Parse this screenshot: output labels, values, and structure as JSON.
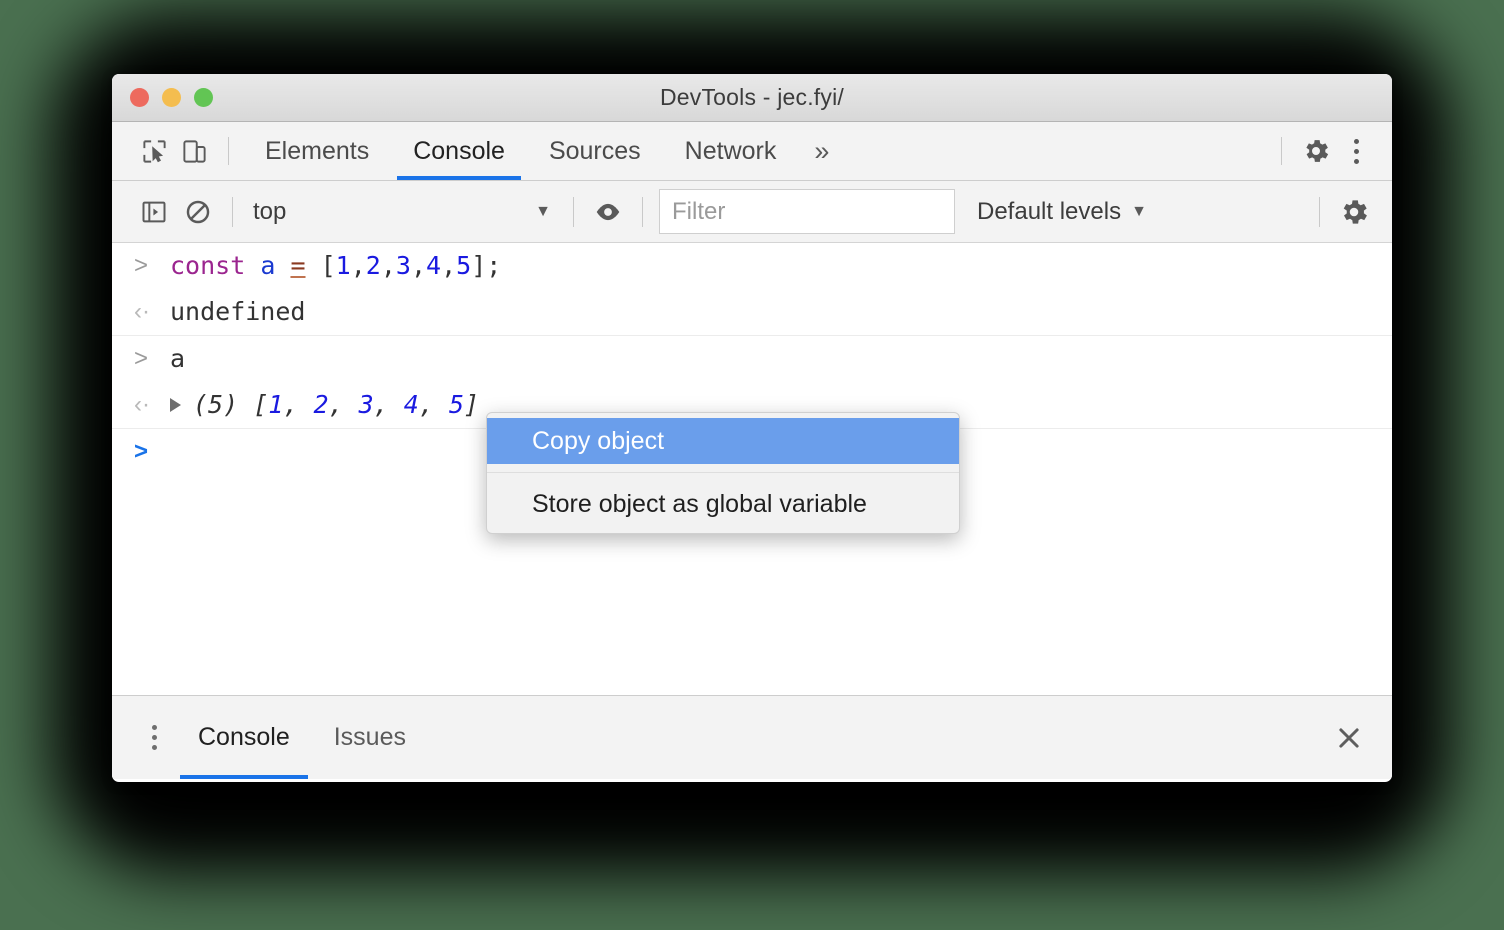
{
  "window": {
    "title": "DevTools - jec.fyi/",
    "traffic_lights": [
      {
        "name": "close",
        "color": "#ed6a5e"
      },
      {
        "name": "minimize",
        "color": "#f4bd4f"
      },
      {
        "name": "zoom",
        "color": "#62c554"
      }
    ]
  },
  "toolbar": {
    "inspect_icon": "inspect-element-icon",
    "device_icon": "device-toolbar-icon",
    "settings_icon": "gear-icon",
    "more_icon": "more-vertical-icon",
    "more_tabs_label": "»"
  },
  "tabs": [
    {
      "label": "Elements",
      "active": false
    },
    {
      "label": "Console",
      "active": true
    },
    {
      "label": "Sources",
      "active": false
    },
    {
      "label": "Network",
      "active": false
    }
  ],
  "console_toolbar": {
    "sidebar_toggle_icon": "console-sidebar-icon",
    "clear_icon": "clear-console-icon",
    "context_value": "top",
    "context_caret": "▼",
    "eye_icon": "live-expression-eye-icon",
    "filter_placeholder": "Filter",
    "filter_value": "",
    "levels_label": "Default levels",
    "levels_caret": "▼",
    "settings_icon": "gear-icon"
  },
  "console": {
    "groups": [
      {
        "messages": [
          {
            "gutter": ">",
            "gutter_kind": "input",
            "type": "code",
            "tokens": [
              {
                "text": "const",
                "cls": "kw"
              },
              {
                "text": " ",
                "cls": "punct"
              },
              {
                "text": "a",
                "cls": "var"
              },
              {
                "text": " ",
                "cls": "punct"
              },
              {
                "text": "=",
                "cls": "op"
              },
              {
                "text": " [",
                "cls": "punct"
              },
              {
                "text": "1",
                "cls": "num"
              },
              {
                "text": ",",
                "cls": "punct"
              },
              {
                "text": "2",
                "cls": "num"
              },
              {
                "text": ",",
                "cls": "punct"
              },
              {
                "text": "3",
                "cls": "num"
              },
              {
                "text": ",",
                "cls": "punct"
              },
              {
                "text": "4",
                "cls": "num"
              },
              {
                "text": ",",
                "cls": "punct"
              },
              {
                "text": "5",
                "cls": "num"
              },
              {
                "text": "];",
                "cls": "punct"
              }
            ],
            "plain": "const a = [1,2,3,4,5];"
          },
          {
            "gutter": "‹·",
            "gutter_kind": "output",
            "type": "text",
            "plain": "undefined"
          }
        ]
      },
      {
        "messages": [
          {
            "gutter": ">",
            "gutter_kind": "input",
            "type": "text",
            "plain": "a"
          },
          {
            "gutter": "‹·",
            "gutter_kind": "output",
            "type": "object",
            "disclosure": true,
            "count_label": "(5)",
            "open_bracket": " [",
            "items": [
              "1",
              "2",
              "3",
              "4",
              "5"
            ],
            "separator": ", ",
            "close_bracket": "]",
            "plain": "(5) [1, 2, 3, 4, 5]"
          }
        ]
      }
    ],
    "prompt": {
      "gutter": ">",
      "value": ""
    }
  },
  "context_menu": {
    "items": [
      {
        "label": "Copy object",
        "selected": true
      },
      {
        "label": "Store object as global variable",
        "selected": false
      }
    ]
  },
  "drawer": {
    "menu_icon": "more-vertical-icon",
    "tabs": [
      {
        "label": "Console",
        "active": true
      },
      {
        "label": "Issues",
        "active": false
      }
    ],
    "close_icon": "close-icon",
    "close_label": "✕"
  },
  "colors": {
    "accent": "#1a73e8",
    "menu_highlight": "#6a9eeb",
    "keyword": "#9b258f",
    "number": "#1a1ae0",
    "page_background": "#4a7050"
  }
}
